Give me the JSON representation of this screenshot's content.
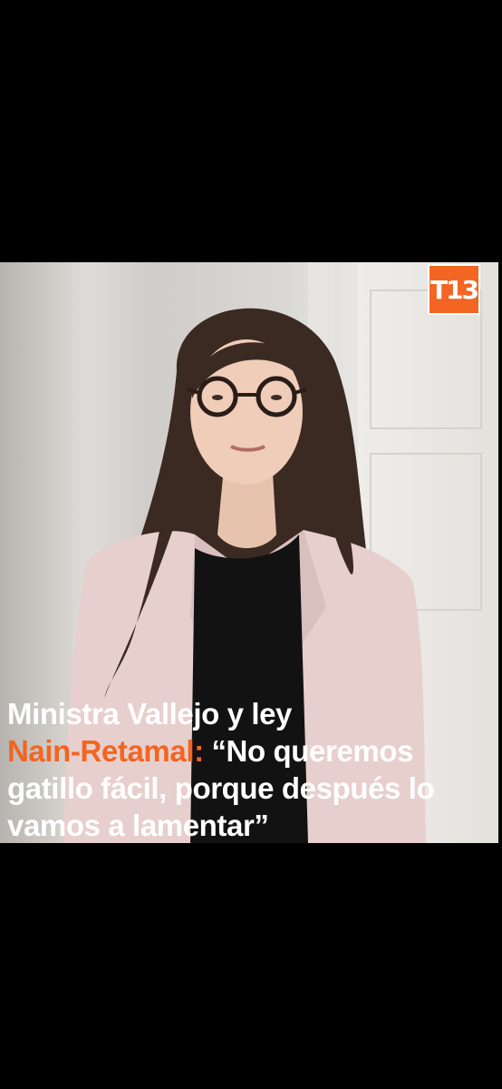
{
  "logo": {
    "text": "T13",
    "color": "#f26522"
  },
  "headline": {
    "line1": "Ministra Vallejo y ley",
    "line2_accent": "Nain-Retamal:",
    "line2_rest": " “No queremos",
    "line3": "gatillo fácil, porque después lo",
    "line4": "vamos a lamentar”"
  },
  "colors": {
    "accent": "#f26522",
    "background": "#000000",
    "text": "#ffffff"
  }
}
